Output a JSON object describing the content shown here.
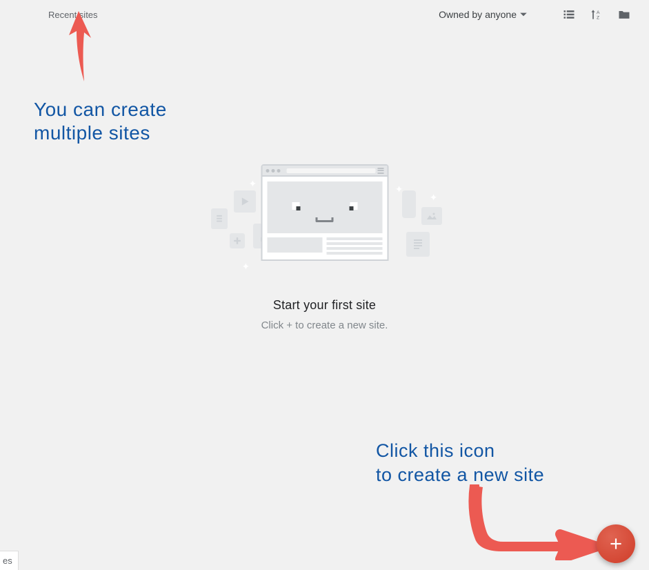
{
  "header": {
    "recent_label": "Recent sites",
    "owned_label": "Owned by anyone"
  },
  "empty_state": {
    "title": "Start your first site",
    "subtitle_prefix": "Click ",
    "subtitle_plus": "+",
    "subtitle_suffix": " to create a new site."
  },
  "annotations": {
    "top": "You can create\nmultiple sites",
    "bottom": "Click this icon\nto create a new site"
  },
  "fragment_text": "es",
  "colors": {
    "anno": "#1256a4",
    "arrow": "#ec5a52",
    "fab": "#d8422d"
  }
}
